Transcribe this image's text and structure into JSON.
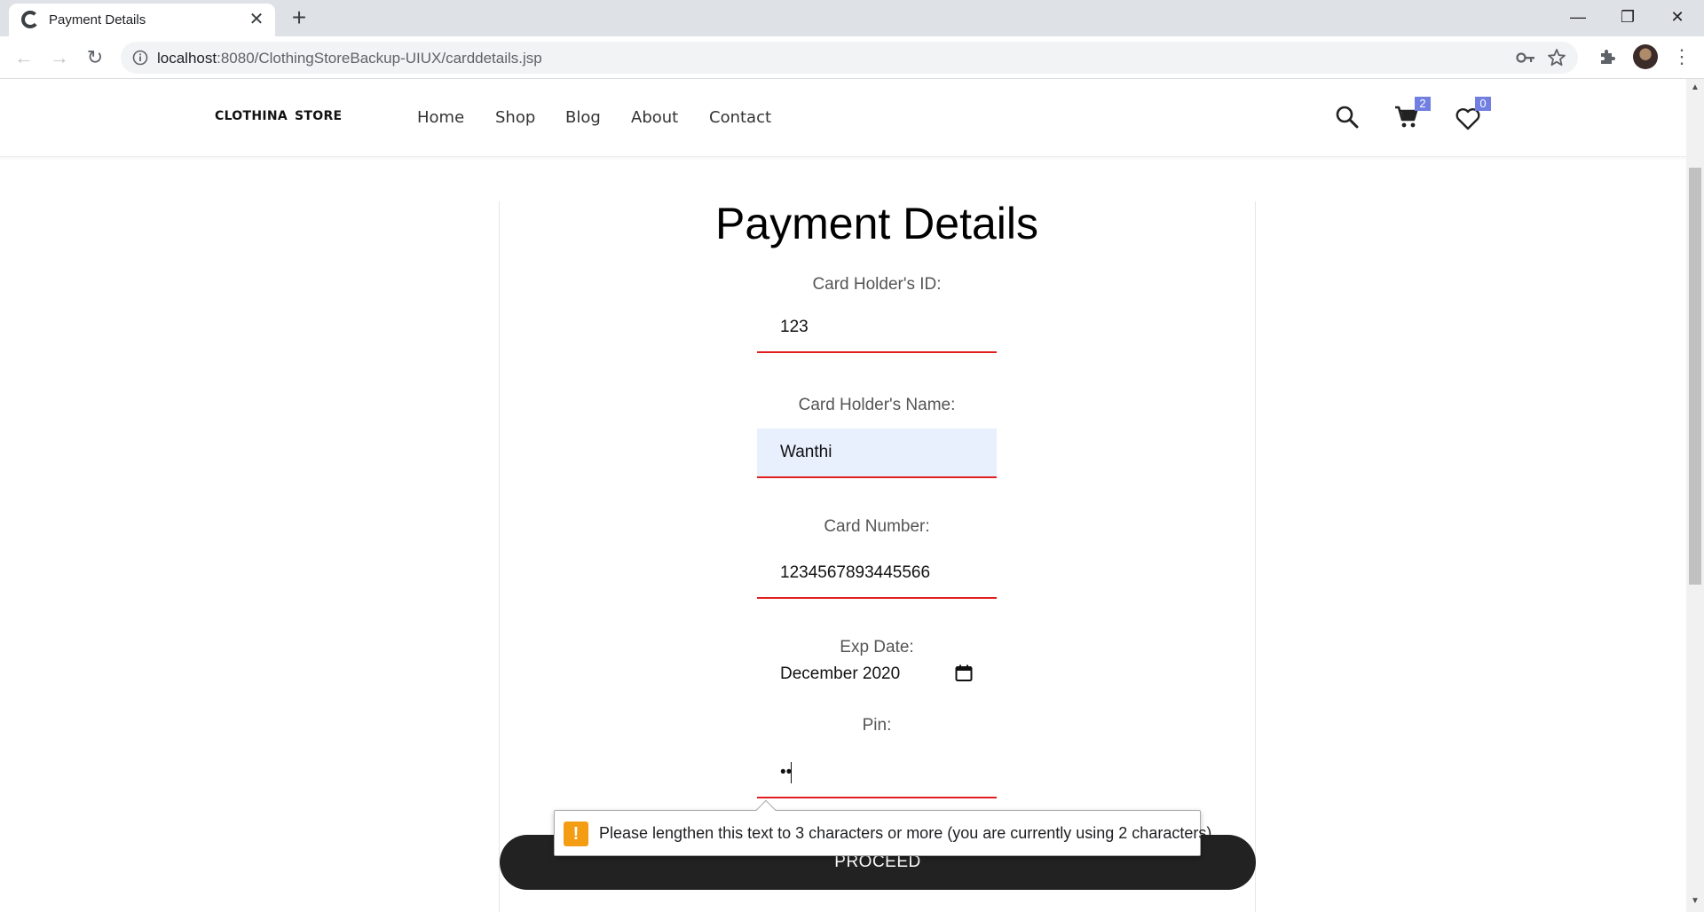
{
  "browser": {
    "tab_title": "Payment Details",
    "url_host": "localhost",
    "url_rest": ":8080/ClothingStoreBackup-UIUX/carddetails.jsp",
    "new_tab_symbol": "+",
    "tab_close_symbol": "✕",
    "window_controls": {
      "minimize": "—",
      "maximize": "❐",
      "close": "✕"
    },
    "nav": {
      "back": "←",
      "forward": "→",
      "reload": "↻",
      "menu": "⋮"
    }
  },
  "site": {
    "logo_part1": "CLOTHINA",
    "logo_part2": "STORE",
    "nav_items": [
      "Home",
      "Shop",
      "Blog",
      "About",
      "Contact"
    ],
    "cart_count": "2",
    "wishlist_count": "0",
    "accent_color": "#717fe0"
  },
  "form": {
    "title": "Payment Details",
    "id_label": "Card Holder's ID:",
    "id_value": "123",
    "name_label": "Card Holder's Name:",
    "name_value": "Wanthi",
    "number_label": "Card Number:",
    "number_value": "1234567893445566",
    "exp_label": "Exp Date:",
    "exp_value": "December 2020",
    "pin_label": "Pin:",
    "pin_value": "••",
    "proceed_label": "PROCEED",
    "error_color": "#e02020"
  },
  "validation": {
    "icon": "!",
    "message": "Please lengthen this text to 3 characters or more (you are currently using 2 characters)."
  },
  "scrollbar": {
    "up": "▲",
    "down": "▼"
  }
}
